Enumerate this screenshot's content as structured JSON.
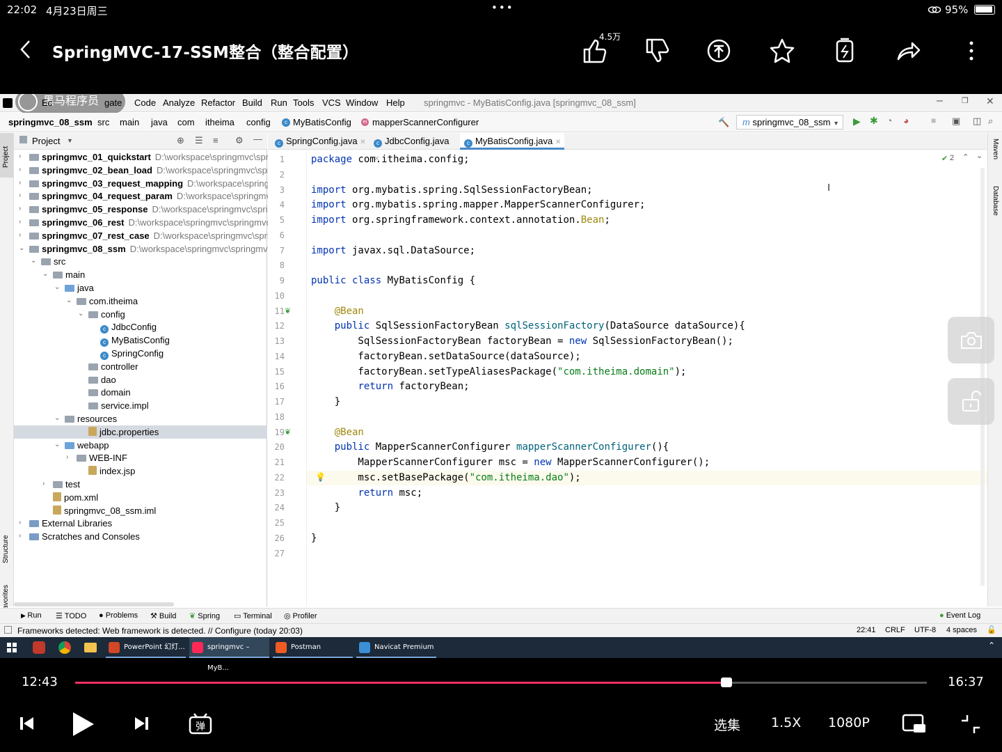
{
  "status_bar": {
    "time": "22:02",
    "date": "4月23日周三",
    "battery": "95%"
  },
  "player": {
    "title": "SpringMVC-17-SSM整合（整合配置）",
    "like_count": "4.5万",
    "current_time": "12:43",
    "total_time": "16:37",
    "progress": 0.765,
    "episodes_label": "选集",
    "speed_label": "1.5X",
    "quality_label": "1080P"
  },
  "ide": {
    "window_title": "springmvc - MyBatisConfig.java [springmvc_08_ssm]",
    "watermark": "黑马程序员",
    "menu": [
      "Code",
      "Analyze",
      "Refactor",
      "Build",
      "Run",
      "Tools",
      "VCS",
      "Window",
      "Help"
    ],
    "menu_partial": "Ec",
    "menu_partial2": "gate",
    "breadcrumb": [
      "springmvc_08_ssm",
      "src",
      "main",
      "java",
      "com",
      "itheima",
      "config",
      "MyBatisConfig",
      "mapperScannerConfigurer"
    ],
    "run_config": "springmvc_08_ssm",
    "project_label": "Project",
    "tree": [
      {
        "name": "springmvc_01_quickstart",
        "path": "D:\\workspace\\springmvc\\spri",
        "indent": 0,
        "type": "module",
        "bold": true
      },
      {
        "name": "springmvc_02_bean_load",
        "path": "D:\\workspace\\springmvc\\spri",
        "indent": 0,
        "type": "module",
        "bold": true
      },
      {
        "name": "springmvc_03_request_mapping",
        "path": "D:\\workspace\\spring",
        "indent": 0,
        "type": "module",
        "bold": true
      },
      {
        "name": "springmvc_04_request_param",
        "path": "D:\\workspace\\springmv",
        "indent": 0,
        "type": "module",
        "bold": true
      },
      {
        "name": "springmvc_05_response",
        "path": "D:\\workspace\\springmvc\\sprir",
        "indent": 0,
        "type": "module",
        "bold": true
      },
      {
        "name": "springmvc_06_rest",
        "path": "D:\\workspace\\springmvc\\springmvc",
        "indent": 0,
        "type": "module",
        "bold": true
      },
      {
        "name": "springmvc_07_rest_case",
        "path": "D:\\workspace\\springmvc\\sprin",
        "indent": 0,
        "type": "module",
        "bold": true
      },
      {
        "name": "springmvc_08_ssm",
        "path": "D:\\workspace\\springmvc\\springmvc",
        "indent": 0,
        "type": "module",
        "bold": true
      },
      {
        "name": "src",
        "path": "",
        "indent": 1,
        "type": "folder",
        "bold": false
      },
      {
        "name": "main",
        "path": "",
        "indent": 2,
        "type": "folder",
        "bold": false
      },
      {
        "name": "java",
        "path": "",
        "indent": 3,
        "type": "folder-blue",
        "bold": false
      },
      {
        "name": "com.itheima",
        "path": "",
        "indent": 4,
        "type": "folder",
        "bold": false
      },
      {
        "name": "config",
        "path": "",
        "indent": 5,
        "type": "folder",
        "bold": false
      },
      {
        "name": "JdbcConfig",
        "path": "",
        "indent": 6,
        "type": "class",
        "bold": false
      },
      {
        "name": "MyBatisConfig",
        "path": "",
        "indent": 6,
        "type": "class",
        "bold": false
      },
      {
        "name": "SpringConfig",
        "path": "",
        "indent": 6,
        "type": "class",
        "bold": false
      },
      {
        "name": "controller",
        "path": "",
        "indent": 5,
        "type": "folder",
        "bold": false
      },
      {
        "name": "dao",
        "path": "",
        "indent": 5,
        "type": "folder",
        "bold": false
      },
      {
        "name": "domain",
        "path": "",
        "indent": 5,
        "type": "folder",
        "bold": false
      },
      {
        "name": "service.impl",
        "path": "",
        "indent": 5,
        "type": "folder",
        "bold": false
      },
      {
        "name": "resources",
        "path": "",
        "indent": 3,
        "type": "folder",
        "bold": false
      },
      {
        "name": "jdbc.properties",
        "path": "",
        "indent": 5,
        "type": "file",
        "bold": false
      },
      {
        "name": "webapp",
        "path": "",
        "indent": 3,
        "type": "folder-blue",
        "bold": false
      },
      {
        "name": "WEB-INF",
        "path": "",
        "indent": 4,
        "type": "folder",
        "bold": false
      },
      {
        "name": "index.jsp",
        "path": "",
        "indent": 5,
        "type": "file",
        "bold": false
      },
      {
        "name": "test",
        "path": "",
        "indent": 2,
        "type": "folder",
        "bold": false
      },
      {
        "name": "pom.xml",
        "path": "",
        "indent": 2,
        "type": "file",
        "bold": false
      },
      {
        "name": "springmvc_08_ssm.iml",
        "path": "",
        "indent": 2,
        "type": "file",
        "bold": false
      },
      {
        "name": "External Libraries",
        "path": "",
        "indent": 0,
        "type": "lib",
        "bold": false
      },
      {
        "name": "Scratches and Consoles",
        "path": "",
        "indent": 0,
        "type": "lib",
        "bold": false
      }
    ],
    "tabs": [
      "SpringConfig.java",
      "JdbcConfig.java",
      "MyBatisConfig.java"
    ],
    "active_tab": 2,
    "inspection_count": "2",
    "code_lines": [
      "package com.itheima.config;",
      "",
      "import org.mybatis.spring.SqlSessionFactoryBean;",
      "import org.mybatis.spring.mapper.MapperScannerConfigurer;",
      "import org.springframework.context.annotation.Bean;",
      "",
      "import javax.sql.DataSource;",
      "",
      "public class MyBatisConfig {",
      "",
      "    @Bean",
      "    public SqlSessionFactoryBean sqlSessionFactory(DataSource dataSource){",
      "        SqlSessionFactoryBean factoryBean = new SqlSessionFactoryBean();",
      "        factoryBean.setDataSource(dataSource);",
      "        factoryBean.setTypeAliasesPackage(\"com.itheima.domain\");",
      "        return factoryBean;",
      "    }",
      "",
      "    @Bean",
      "    public MapperScannerConfigurer mapperScannerConfigurer(){",
      "        MapperScannerConfigurer msc = new MapperScannerConfigurer();",
      "        msc.setBasePackage(\"com.itheima.dao\");",
      "        return msc;",
      "    }",
      "",
      "}",
      ""
    ],
    "current_line": 22,
    "tool_windows": [
      "Run",
      "TODO",
      "Problems",
      "Build",
      "Spring",
      "Terminal",
      "Profiler"
    ],
    "event_log": "Event Log",
    "status_message": "Frameworks detected: Web framework is detected. // Configure (today 20:03)",
    "cursor_pos": "22:41",
    "line_sep": "CRLF",
    "encoding": "UTF-8",
    "indent": "4 spaces",
    "side_labels": {
      "project": "Project",
      "structure": "Structure",
      "favorites": "Favorites",
      "maven": "Maven",
      "database": "Database"
    }
  },
  "taskbar": [
    {
      "label": "PowerPoint 幻灯...",
      "color": "#d24726"
    },
    {
      "label": "springmvc – MyB...",
      "color": "#fe2857"
    },
    {
      "label": "Postman",
      "color": "#ef5b25"
    },
    {
      "label": "Navicat Premium",
      "color": "#3b8fd6"
    }
  ]
}
